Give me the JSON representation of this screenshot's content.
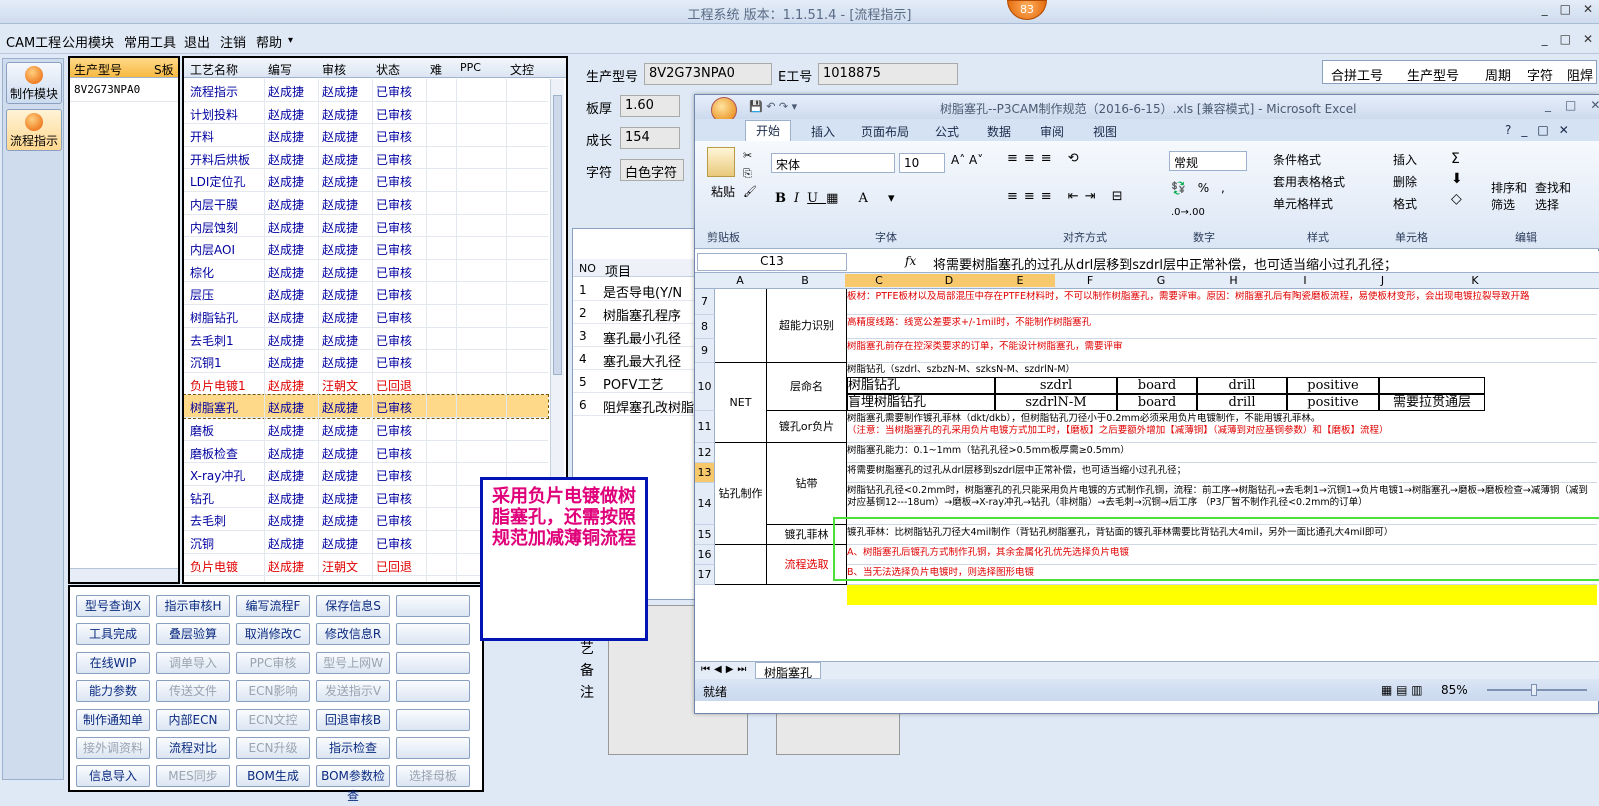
{
  "app": {
    "title": "工程系统   版本：1.1.51.4 - [流程指示]",
    "badge": "83",
    "window_buttons": [
      "_",
      "□",
      "✕"
    ]
  },
  "menu": {
    "items": [
      "CAM工程",
      "公用模块",
      "常用工具",
      "退出",
      "注销",
      "帮助"
    ],
    "dropdown_arrow": "▾",
    "combo_value": ""
  },
  "leftnav": [
    {
      "label": "制作模块",
      "icon": "gear-orange-icon"
    },
    {
      "label": "流程指示",
      "icon": "flow-orange-icon"
    }
  ],
  "model_panel": {
    "headers": [
      "生产型号",
      "S板"
    ],
    "rows": [
      "8V2G73NPA0"
    ]
  },
  "process_panel": {
    "headers": [
      "工艺名称",
      "编写",
      "审核",
      "状态",
      "难",
      "PPC",
      "文控"
    ],
    "rows": [
      {
        "name": "流程指示",
        "writer": "赵成捷",
        "reviewer": "赵成捷",
        "status": "已审核",
        "red": false
      },
      {
        "name": "计划投料",
        "writer": "赵成捷",
        "reviewer": "赵成捷",
        "status": "已审核",
        "red": false
      },
      {
        "name": "开料",
        "writer": "赵成捷",
        "reviewer": "赵成捷",
        "status": "已审核",
        "red": false
      },
      {
        "name": "开料后烘板",
        "writer": "赵成捷",
        "reviewer": "赵成捷",
        "status": "已审核",
        "red": false
      },
      {
        "name": "LDI定位孔",
        "writer": "赵成捷",
        "reviewer": "赵成捷",
        "status": "已审核",
        "red": false
      },
      {
        "name": "内层干膜",
        "writer": "赵成捷",
        "reviewer": "赵成捷",
        "status": "已审核",
        "red": false
      },
      {
        "name": "内层蚀刻",
        "writer": "赵成捷",
        "reviewer": "赵成捷",
        "status": "已审核",
        "red": false
      },
      {
        "name": "内层AOI",
        "writer": "赵成捷",
        "reviewer": "赵成捷",
        "status": "已审核",
        "red": false
      },
      {
        "name": "棕化",
        "writer": "赵成捷",
        "reviewer": "赵成捷",
        "status": "已审核",
        "red": false
      },
      {
        "name": "层压",
        "writer": "赵成捷",
        "reviewer": "赵成捷",
        "status": "已审核",
        "red": false
      },
      {
        "name": "树脂钻孔",
        "writer": "赵成捷",
        "reviewer": "赵成捷",
        "status": "已审核",
        "red": false
      },
      {
        "name": "去毛刺1",
        "writer": "赵成捷",
        "reviewer": "赵成捷",
        "status": "已审核",
        "red": false
      },
      {
        "name": "沉铜1",
        "writer": "赵成捷",
        "reviewer": "赵成捷",
        "status": "已审核",
        "red": false
      },
      {
        "name": "负片电镀1",
        "writer": "赵成捷",
        "reviewer": "汪朝文",
        "status": "已回退",
        "red": true
      },
      {
        "name": "树脂塞孔",
        "writer": "赵成捷",
        "reviewer": "赵成捷",
        "status": "已审核",
        "red": false,
        "selected": true
      },
      {
        "name": "磨板",
        "writer": "赵成捷",
        "reviewer": "赵成捷",
        "status": "已审核",
        "red": false
      },
      {
        "name": "磨板检查",
        "writer": "赵成捷",
        "reviewer": "赵成捷",
        "status": "已审核",
        "red": false
      },
      {
        "name": "X-ray冲孔",
        "writer": "赵成捷",
        "reviewer": "赵成捷",
        "status": "已审核",
        "red": false
      },
      {
        "name": "钻孔",
        "writer": "赵成捷",
        "reviewer": "赵成捷",
        "status": "已审核",
        "red": false
      },
      {
        "name": "去毛刺",
        "writer": "赵成捷",
        "reviewer": "赵成捷",
        "status": "已审核",
        "red": false
      },
      {
        "name": "沉铜",
        "writer": "赵成捷",
        "reviewer": "赵成捷",
        "status": "已审核",
        "red": false
      },
      {
        "name": "负片电镀",
        "writer": "赵成捷",
        "reviewer": "汪朝文",
        "status": "已回退",
        "red": true
      }
    ]
  },
  "buttons": [
    [
      {
        "l": "型号查询X",
        "d": false
      },
      {
        "l": "指示审核H",
        "d": false
      },
      {
        "l": "编写流程F",
        "d": false
      },
      {
        "l": "保存信息S",
        "d": false
      },
      {
        "l": "",
        "d": false
      }
    ],
    [
      {
        "l": "工具完成",
        "d": false
      },
      {
        "l": "叠层验算",
        "d": false
      },
      {
        "l": "取消修改C",
        "d": false
      },
      {
        "l": "修改信息R",
        "d": false
      },
      {
        "l": "",
        "d": false
      }
    ],
    [
      {
        "l": "在线WIP",
        "d": false
      },
      {
        "l": "调单导入",
        "d": true
      },
      {
        "l": "PPC审核",
        "d": true
      },
      {
        "l": "型号上网W",
        "d": true
      },
      {
        "l": "",
        "d": false
      }
    ],
    [
      {
        "l": "能力参数",
        "d": false
      },
      {
        "l": "传送文件",
        "d": true
      },
      {
        "l": "ECN影响",
        "d": true
      },
      {
        "l": "发送指示V",
        "d": true
      },
      {
        "l": "",
        "d": false
      }
    ],
    [
      {
        "l": "制作通知单",
        "d": false
      },
      {
        "l": "内部ECN",
        "d": false
      },
      {
        "l": "ECN文控",
        "d": true
      },
      {
        "l": "回退审核B",
        "d": false
      },
      {
        "l": "",
        "d": false
      }
    ],
    [
      {
        "l": "接外调资料",
        "d": true
      },
      {
        "l": "流程对比",
        "d": false
      },
      {
        "l": "ECN升级",
        "d": true
      },
      {
        "l": "指示检查",
        "d": false
      },
      {
        "l": "",
        "d": false
      }
    ],
    [
      {
        "l": "信息导入",
        "d": false
      },
      {
        "l": "MES同步",
        "d": true
      },
      {
        "l": "BOM生成",
        "d": false
      },
      {
        "l": "BOM参数检查",
        "d": false
      },
      {
        "l": "选择母板",
        "d": true
      }
    ]
  ],
  "info": {
    "model_label": "生产型号",
    "model_value": "8V2G73NPA0",
    "eno_label": "E工号",
    "eno_value": "1018875",
    "thick_label": "板厚",
    "thick_value": "1.60",
    "grow_label": "成长",
    "grow_value": "154",
    "char_label": "字符",
    "char_value": "白色字符"
  },
  "merge_table": {
    "headers": [
      "合拼工号",
      "生产型号",
      "周期",
      "字符",
      "阻焊"
    ]
  },
  "items_table": {
    "headers": [
      "NO",
      "项目"
    ],
    "rows": [
      [
        "1",
        "是否导电(Y/N"
      ],
      [
        "2",
        "树脂塞孔程序"
      ],
      [
        "3",
        "塞孔最小孔径"
      ],
      [
        "4",
        "塞孔最大孔径"
      ],
      [
        "5",
        "POFV工艺"
      ],
      [
        "6",
        "阻焊塞孔改树脂"
      ]
    ]
  },
  "side_label": "艺备注",
  "callout": "采用负片电镀做树脂塞孔，还需按照规范加减薄铜流程",
  "excel": {
    "title": "树脂塞孔--P3CAM制作规范（2016-6-15）.xls  [兼容模式] - Microsoft Excel",
    "tabs": [
      "开始",
      "插入",
      "页面布局",
      "公式",
      "数据",
      "审阅",
      "视图"
    ],
    "font_name": "宋体",
    "font_size": "10",
    "num_format": "常规",
    "groups": [
      "剪贴板",
      "字体",
      "对齐方式",
      "数字",
      "样式",
      "单元格",
      "编辑"
    ],
    "ribbon_labels": [
      "粘贴",
      "条件格式",
      "套用表格格式",
      "单元格样式",
      "插入",
      "删除",
      "格式",
      "排序和筛选",
      "查找和选择"
    ],
    "cell_ref": "C13",
    "formula": "将需要树脂塞孔的过孔从drl层移到szdrl层中正常补偿，也可适当缩小过孔孔径；",
    "columns": [
      "A",
      "B",
      "C",
      "D",
      "E",
      "F",
      "G",
      "H",
      "I",
      "J",
      "K"
    ],
    "sheet_tab": "树脂塞孔",
    "status": "就绪",
    "zoom": "85%",
    "rows": [
      {
        "n": "7",
        "text": "板材：PTFE板材以及局部混压中存在PTFE材料时，不可以制作树脂塞孔，需要评审。原因：树脂塞孔后有陶瓷磨板流程，易使板材变形，会出现电镀拉裂导致开路",
        "red": true
      },
      {
        "n": "8",
        "text": "高精度线路：线宽公差要求+/-1mil时，不能制作树脂塞孔",
        "red": true
      },
      {
        "n": "9",
        "text": "树脂塞孔前存在控深类要求的订单，不能设计树脂塞孔，需要评审",
        "red": true
      },
      {
        "n": "10",
        "text": "树脂钻孔（szdrl、szbzN-M、szksN-M、szdrlN-M）",
        "red": false
      },
      {
        "n": "11",
        "text": "树脂塞孔需要制作镀孔菲林（dkt/dkb），但树脂钻孔刀径小于0.2mm必须采用负片电镀制作，不能用镀孔菲林。",
        "red": false
      },
      {
        "n": "12",
        "text": "树脂塞孔能力：0.1~1mm（钻孔孔径>0.5mm板厚需≥0.5mm）",
        "red": false
      },
      {
        "n": "13",
        "text": "将需要树脂塞孔的过孔从drl层移到szdrl层中正常补偿，也可适当缩小过孔孔径；",
        "red": false
      },
      {
        "n": "14",
        "text": "树脂钻孔孔径<0.2mm时，树脂塞孔的孔只能采用负片电镀的方式制作孔铜，流程：前工序→树脂钻孔→去毛刺1→沉铜1→负片电镀1→树脂塞孔→磨板→磨板检查→减薄铜（减到对应基铜12---18um）→磨板→X-ray冲孔→钻孔（非树脂）→去毛刺→沉铜→后工序  （P3厂暂不制作孔径<0.2mm的订单）",
        "red": false
      },
      {
        "n": "15",
        "text": "镀孔菲林：比树脂钻孔刀径大4mil制作（背钻孔树脂塞孔，背钻面的镀孔菲林需要比背钻孔大4mil，另外一面比通孔大4mil即可）",
        "red": false
      },
      {
        "n": "16",
        "text": "A、树脂塞孔后镀孔方式制作孔铜，其余金属化孔优先选择负片电镀",
        "red": true
      },
      {
        "n": "17",
        "text": "B、当无法选择负片电镀时，则选择图形电镀",
        "red": true
      }
    ],
    "b_labels": {
      "r7": "超能力识别",
      "r10": "层命名",
      "r11": "镀孔or负片",
      "r13": "钻带",
      "r15": "镀孔菲林",
      "r16": "流程选取"
    },
    "a_labels": {
      "net": "NET",
      "drill": "钻孔制作"
    },
    "naming": [
      [
        "树脂钻孔",
        "szdrl",
        "board",
        "drill",
        "positive",
        ""
      ],
      [
        "盲埋树脂钻孔",
        "szdrlN-M",
        "board",
        "drill",
        "positive",
        "需要拉贯通层"
      ]
    ],
    "note11": "（注意：当树脂塞孔的孔采用负片电镀方式加工时，【磨板】之后要额外增加【减薄铜】（减薄到对应基铜参数）和【磨板】流程）"
  }
}
